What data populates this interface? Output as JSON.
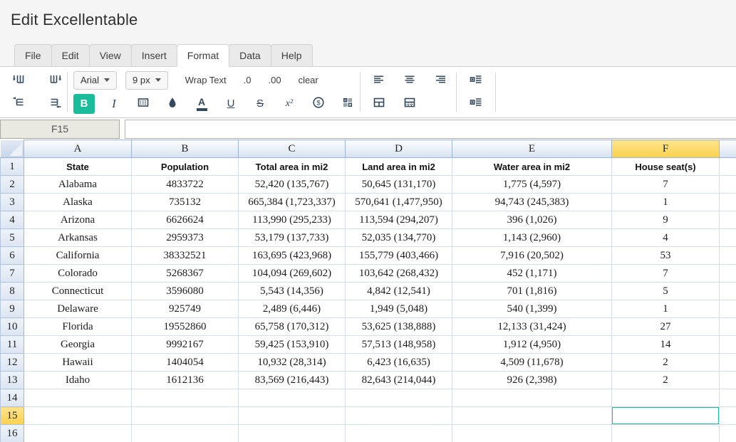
{
  "window": {
    "title": "Edit Excellentable"
  },
  "menu": {
    "items": [
      "File",
      "Edit",
      "View",
      "Insert",
      "Format",
      "Data",
      "Help"
    ],
    "active_item": "Format"
  },
  "toolbar": {
    "font_family": "Arial",
    "font_size": "9 px",
    "wrap_text": "Wrap Text",
    "decimal_decrease": ".0",
    "decimal_increase": ".00",
    "clear": "clear",
    "bold": "B",
    "italic": "I",
    "underline": "U",
    "strikethrough": "S",
    "superscript": "x²",
    "font_color_letter": "A",
    "currency_symbol": "$",
    "active_button": "bold",
    "icon_color": "#34495e",
    "icon_names": [
      "insert-column-left",
      "insert-column-right",
      "insert-row-above",
      "insert-row-below",
      "borders",
      "fill-color",
      "font-color",
      "currency",
      "keypad",
      "align-left",
      "align-center",
      "align-right",
      "merge-cells",
      "border-grid",
      "indent-increase",
      "indent-decrease",
      "dropdown-caret"
    ]
  },
  "formula_bar": {
    "cell_reference": "F15",
    "value": ""
  },
  "sheet": {
    "selected_cell": "F15",
    "highlighted_column": "F",
    "highlighted_row": 15,
    "column_letters": [
      "A",
      "B",
      "C",
      "D",
      "E",
      "F",
      ""
    ],
    "first_row_number": 1,
    "row_count": 16,
    "rows": [
      {
        "row": 1,
        "bold": true,
        "cells": [
          "State",
          "Population",
          "Total area in mi2",
          "Land area in mi2",
          "Water area in mi2",
          "House seat(s)"
        ]
      },
      {
        "row": 2,
        "cells": [
          "Alabama",
          "4833722",
          "52,420 (135,767)",
          "50,645 (131,170)",
          "1,775 (4,597)",
          "7"
        ]
      },
      {
        "row": 3,
        "cells": [
          "Alaska",
          "735132",
          "665,384 (1,723,337)",
          "570,641 (1,477,950)",
          "94,743 (245,383)",
          "1"
        ]
      },
      {
        "row": 4,
        "cells": [
          "Arizona",
          "6626624",
          "113,990 (295,233)",
          "113,594 (294,207)",
          "396 (1,026)",
          "9"
        ]
      },
      {
        "row": 5,
        "cells": [
          "Arkansas",
          "2959373",
          "53,179 (137,733)",
          "52,035 (134,770)",
          "1,143 (2,960)",
          "4"
        ]
      },
      {
        "row": 6,
        "cells": [
          "California",
          "38332521",
          "163,695 (423,968)",
          "155,779 (403,466)",
          "7,916 (20,502)",
          "53"
        ]
      },
      {
        "row": 7,
        "cells": [
          "Colorado",
          "5268367",
          "104,094 (269,602)",
          "103,642 (268,432)",
          "452 (1,171)",
          "7"
        ]
      },
      {
        "row": 8,
        "cells": [
          "Connecticut",
          "3596080",
          "5,543 (14,356)",
          "4,842 (12,541)",
          "701 (1,816)",
          "5"
        ]
      },
      {
        "row": 9,
        "cells": [
          "Delaware",
          "925749",
          "2,489 (6,446)",
          "1,949 (5,048)",
          "540 (1,399)",
          "1"
        ]
      },
      {
        "row": 10,
        "cells": [
          "Florida",
          "19552860",
          "65,758 (170,312)",
          "53,625 (138,888)",
          "12,133 (31,424)",
          "27"
        ]
      },
      {
        "row": 11,
        "cells": [
          "Georgia",
          "9992167",
          "59,425 (153,910)",
          "57,513 (148,958)",
          "1,912 (4,950)",
          "14"
        ]
      },
      {
        "row": 12,
        "cells": [
          "Hawaii",
          "1404054",
          "10,932 (28,314)",
          "6,423 (16,635)",
          "4,509 (11,678)",
          "2"
        ]
      },
      {
        "row": 13,
        "cells": [
          "Idaho",
          "1612136",
          "83,569 (216,443)",
          "82,643 (214,044)",
          "926 (2,398)",
          "2"
        ]
      },
      {
        "row": 14,
        "cells": [
          "",
          "",
          "",
          "",
          "",
          ""
        ]
      },
      {
        "row": 15,
        "cells": [
          "",
          "",
          "",
          "",
          "",
          ""
        ]
      },
      {
        "row": 16,
        "cells": [
          "",
          "",
          "",
          "",
          "",
          ""
        ]
      }
    ],
    "colors": {
      "selection_border": "#1bbc9b",
      "column_row_highlight": "#fbd14e",
      "header_border": "#9fb6d4",
      "gridline": "#d4dde9"
    }
  }
}
